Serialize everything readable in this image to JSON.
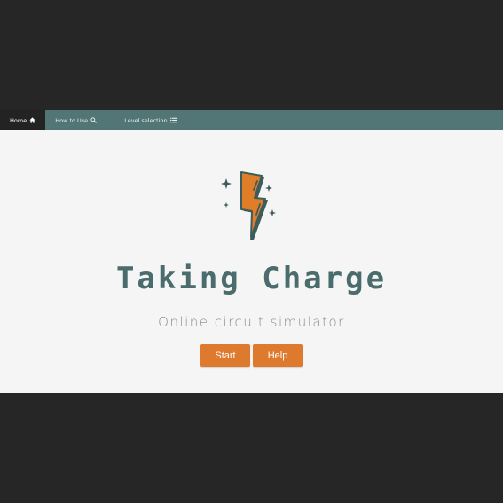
{
  "nav": {
    "items": [
      {
        "label": "Home",
        "icon": "home-icon",
        "active": true
      },
      {
        "label": "How to Use",
        "icon": "magnifier-icon",
        "active": false
      },
      {
        "label": "Level selection",
        "icon": "list-icon",
        "active": false
      }
    ]
  },
  "hero": {
    "title": "Taking Charge",
    "subtitle": "Online circuit simulator",
    "start_label": "Start",
    "help_label": "Help",
    "logo_icon": "lightning-bolt-icon"
  },
  "colors": {
    "background": "#262626",
    "navbar": "#527575",
    "nav_active": "#232323",
    "hero_bg": "#f5f5f5",
    "title": "#4a6c6c",
    "accent": "#dd7a2e"
  }
}
